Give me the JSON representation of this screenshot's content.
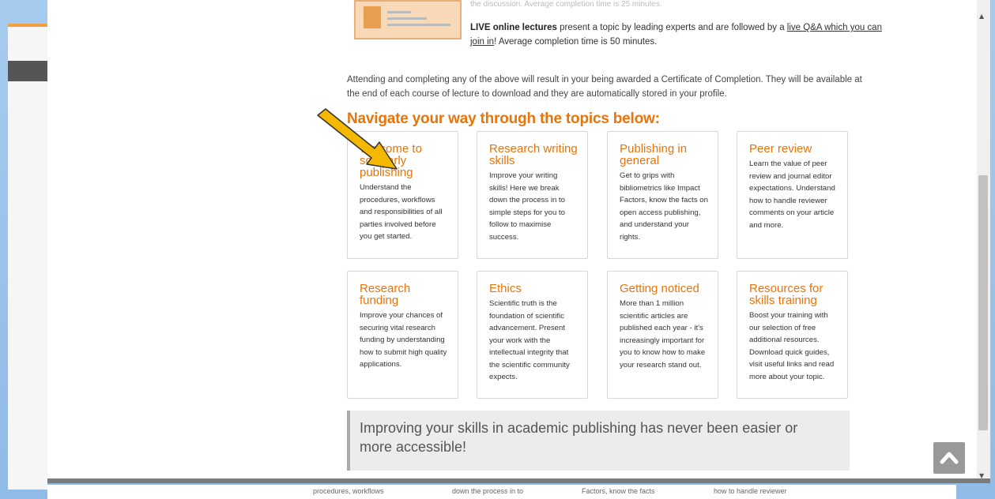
{
  "intro": {
    "faded_top_line": "the discussion. Average completion time is 25 minutes.",
    "live_bold": "LIVE online lectures",
    "live_text": " present a topic by leading experts and are followed by a ",
    "live_link": "live Q&A which you can join in",
    "live_end": "! Average completion time is 50 minutes.",
    "certificate_text": "Attending and completing any of the above will result in your being awarded a Certificate of Completion. They will be available at the end of each course of lecture to download and they are automatically stored in your profile."
  },
  "heading": "Navigate your way through the topics below:",
  "topics": [
    {
      "title": "Welcome to scholarly publishing",
      "desc": "Understand the procedures, workflows and responsibilities of all parties involved before you get started."
    },
    {
      "title": "Research writing skills",
      "desc": "Improve your writing skills! Here we break down the process in to simple steps for you to follow to maximise success."
    },
    {
      "title": "Publishing in general",
      "desc": "Get to grips with bibliometrics like Impact Factors, know the facts on open access publishing, and understand your rights."
    },
    {
      "title": "Peer review",
      "desc": "Learn the value of peer review and journal editor expectations. Understand how to handle reviewer comments on your article and more."
    },
    {
      "title": "Research funding",
      "desc": "Improve your chances of securing vital research funding by understanding how to submit high quality applications."
    },
    {
      "title": "Ethics",
      "desc": "Scientific truth is the foundation of scientific advancement. Present your work with the intellectual integrity that the scientific community expects."
    },
    {
      "title": "Getting noticed",
      "desc": "More than 1 million scientific articles are published each year - it's increasingly important for you to know how to make your research stand out."
    },
    {
      "title": "Resources for skills training",
      "desc": "Boost your training with our selection of free additional resources. Download quick guides, visit useful links and read more about your topic."
    }
  ],
  "banner": "Improving your skills in academic publishing has never been easier or more accessible!",
  "background_strip": [
    "procedures, workflows",
    "down the process in to",
    "Factors, know the facts",
    "how to handle reviewer"
  ],
  "colors": {
    "accent": "#e8740a",
    "arrow": "#f5b800"
  },
  "icons": {
    "scroll_top": "chevron-up-icon"
  }
}
